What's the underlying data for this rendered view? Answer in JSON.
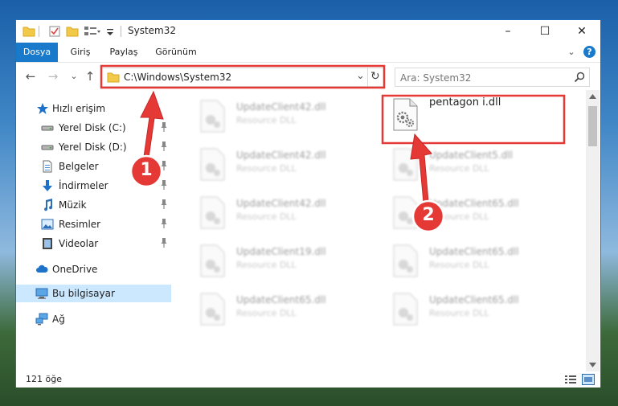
{
  "window": {
    "title": "System32"
  },
  "title_buttons": {
    "minimize": "–",
    "maximize": "☐",
    "close": "✕"
  },
  "ribbon": {
    "tabs": [
      "Dosya",
      "Giriş",
      "Paylaş",
      "Görünüm"
    ],
    "expand": "⌄",
    "help": "?"
  },
  "nav": {
    "back": "←",
    "forward": "→",
    "recent": "⌄",
    "up": "↑"
  },
  "address": {
    "path": "C:\\Windows\\System32",
    "dropdown": "⌄",
    "refresh": "↻"
  },
  "search": {
    "placeholder": "Ara: System32"
  },
  "sidebar": {
    "items": [
      {
        "label": "Hızlı erişim",
        "icon": "star-icon"
      },
      {
        "label": "Yerel Disk (C:)",
        "icon": "drive-icon",
        "pinned": true
      },
      {
        "label": "Yerel Disk (D:)",
        "icon": "drive-icon",
        "pinned": true
      },
      {
        "label": "Belgeler",
        "icon": "documents-icon",
        "pinned": true
      },
      {
        "label": "İndirmeler",
        "icon": "downloads-icon",
        "pinned": true
      },
      {
        "label": "Müzik",
        "icon": "music-icon",
        "pinned": true
      },
      {
        "label": "Resimler",
        "icon": "pictures-icon",
        "pinned": true
      },
      {
        "label": "Videolar",
        "icon": "videos-icon",
        "pinned": true
      },
      {
        "label": "OneDrive",
        "icon": "cloud-icon"
      },
      {
        "label": "Bu bilgisayar",
        "icon": "computer-icon",
        "selected": true
      },
      {
        "label": "Ağ",
        "icon": "network-icon"
      }
    ]
  },
  "files": [
    {
      "name": "UpdateClient42.dll",
      "type": "Resource DLL",
      "blurred": true
    },
    {
      "name": "pentagon i.dll",
      "type": "",
      "blurred": false,
      "highlighted": true
    },
    {
      "name": "UpdateClient42.dll",
      "type": "Resource DLL",
      "blurred": true
    },
    {
      "name": "UpdateClient5.dll",
      "type": "Resource DLL",
      "blurred": true
    },
    {
      "name": "UpdateClient42.dll",
      "type": "Resource DLL",
      "blurred": true
    },
    {
      "name": "UpdateClient65.dll",
      "type": "Resource DLL",
      "blurred": true
    },
    {
      "name": "UpdateClient19.dll",
      "type": "Resource DLL",
      "blurred": true
    },
    {
      "name": "UpdateClient65.dll",
      "type": "Resource DLL",
      "blurred": true
    },
    {
      "name": "UpdateClient65.dll",
      "type": "Resource DLL",
      "blurred": true
    },
    {
      "name": "UpdateClient65.dll",
      "type": "Resource DLL",
      "blurred": true
    }
  ],
  "status": {
    "count": "121 öğe"
  },
  "annotations": {
    "step1": "1",
    "step2": "2",
    "color": "#e53935"
  }
}
